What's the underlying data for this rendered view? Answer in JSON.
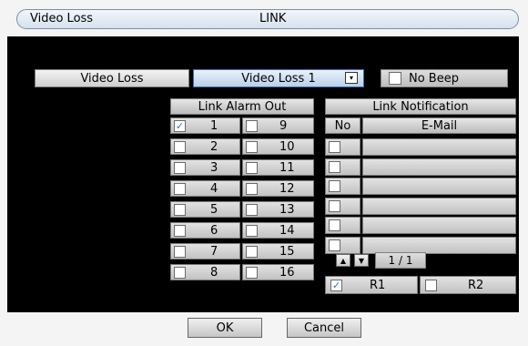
{
  "window": {
    "title": "Video Loss",
    "section": "LINK"
  },
  "event_type": {
    "label": "Video Loss",
    "selected": "Video Loss 1",
    "dropdown_icon": "dropdown-arrow-icon"
  },
  "no_beep": {
    "label": "No Beep",
    "checked": false
  },
  "link_alarm_out": {
    "header": "Link Alarm Out",
    "left": [
      {
        "n": "1",
        "checked": true
      },
      {
        "n": "2",
        "checked": false
      },
      {
        "n": "3",
        "checked": false
      },
      {
        "n": "4",
        "checked": false
      },
      {
        "n": "5",
        "checked": false
      },
      {
        "n": "6",
        "checked": false
      },
      {
        "n": "7",
        "checked": false
      },
      {
        "n": "8",
        "checked": false
      }
    ],
    "right": [
      {
        "n": "9",
        "checked": false
      },
      {
        "n": "10",
        "checked": false
      },
      {
        "n": "11",
        "checked": false
      },
      {
        "n": "12",
        "checked": false
      },
      {
        "n": "13",
        "checked": false
      },
      {
        "n": "14",
        "checked": false
      },
      {
        "n": "15",
        "checked": false
      },
      {
        "n": "16",
        "checked": false
      }
    ]
  },
  "link_notification": {
    "header": "Link Notification",
    "col_no": "No",
    "col_email": "E-Mail",
    "rows": [
      {
        "checked": false,
        "email": ""
      },
      {
        "checked": false,
        "email": ""
      },
      {
        "checked": false,
        "email": ""
      },
      {
        "checked": false,
        "email": ""
      },
      {
        "checked": false,
        "email": ""
      },
      {
        "checked": false,
        "email": ""
      }
    ],
    "page": "1 / 1"
  },
  "relays": [
    {
      "label": "R1",
      "checked": true
    },
    {
      "label": "R2",
      "checked": false
    }
  ],
  "buttons": {
    "ok": "OK",
    "cancel": "Cancel"
  },
  "check_mark": "✓"
}
